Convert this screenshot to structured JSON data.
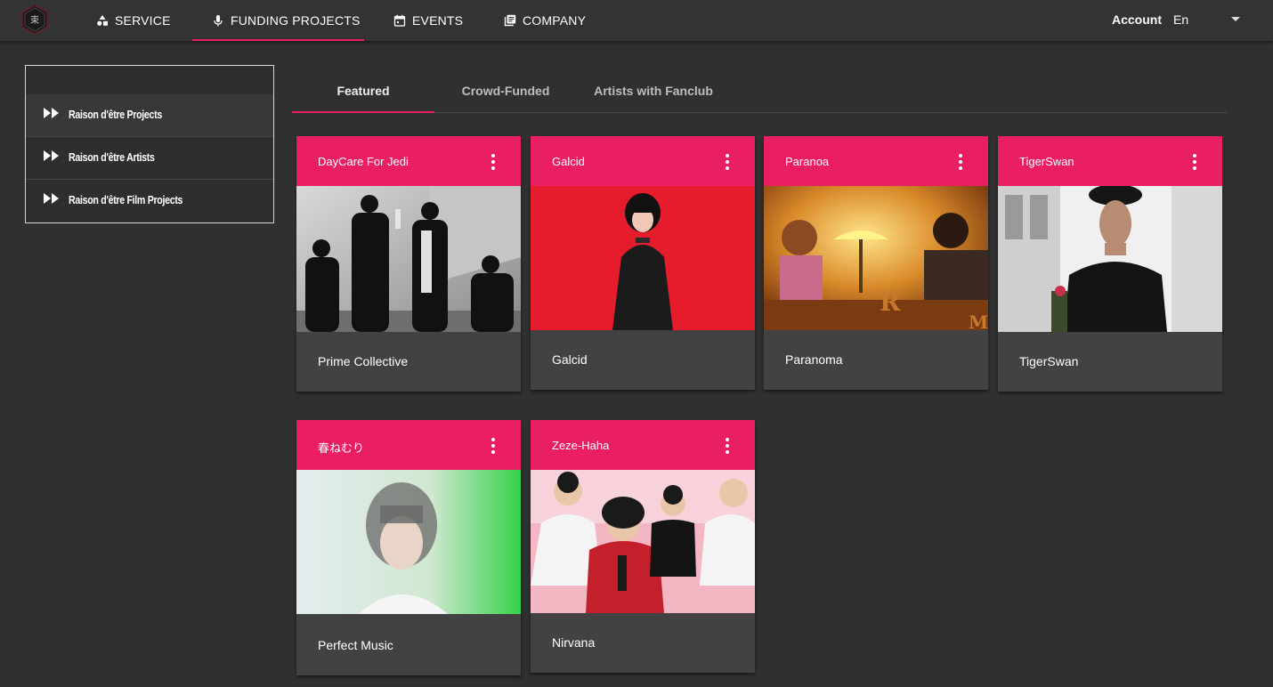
{
  "nav": {
    "items": [
      {
        "label": "SERVICE",
        "icon": "shapes-icon"
      },
      {
        "label": "FUNDING PROJECTS",
        "icon": "microphone-icon"
      },
      {
        "label": "EVENTS",
        "icon": "calendar-icon"
      },
      {
        "label": "COMPANY",
        "icon": "library-icon"
      }
    ],
    "active_index": 1,
    "account": "Account",
    "language": "En"
  },
  "sidebar": {
    "items": [
      {
        "label": "Raison d'être Projects"
      },
      {
        "label": "Raison d'être Artists"
      },
      {
        "label": "Raison d'être Film Projects"
      }
    ]
  },
  "tabs": {
    "items": [
      {
        "label": "Featured"
      },
      {
        "label": "Crowd-Funded"
      },
      {
        "label": "Artists with Fanclub"
      }
    ],
    "active_index": 0
  },
  "cards": [
    {
      "title": "DayCare For Jedi",
      "caption": "Prime Collective"
    },
    {
      "title": "Galcid",
      "caption": "Galcid"
    },
    {
      "title": "Paranoa",
      "caption": "Paranoma"
    },
    {
      "title": "TigerSwan",
      "caption": "TigerSwan"
    },
    {
      "title": "春ねむり",
      "caption": "Perfect Music"
    },
    {
      "title": "Zeze-Haha",
      "caption": "Nirvana"
    }
  ],
  "colors": {
    "accent": "#e91e63",
    "background": "#303030",
    "card": "#424242",
    "topbar": "#333333"
  }
}
